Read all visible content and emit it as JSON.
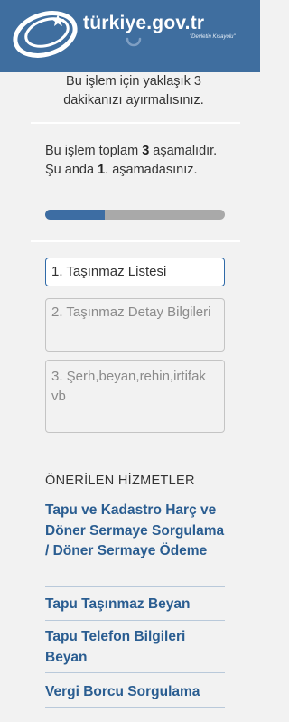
{
  "header": {
    "brand": "türkiye.gov.tr",
    "tagline": "\"Devletin Kısayolu\""
  },
  "info": {
    "time_note": "Bu işlem için yaklaşık 3 dakikanızı ayırmalısınız.",
    "stage_prefix": "Bu işlem toplam ",
    "total_stages": "3",
    "stage_middle": " aşamalıdır. Şu anda ",
    "current_stage": "1",
    "stage_suffix": ". aşamadasınız.",
    "progress_fraction": 0.333
  },
  "steps": [
    {
      "label": "1. Taşınmaz Listesi",
      "active": true
    },
    {
      "label": "2. Taşınmaz Detay Bilgileri",
      "active": false
    },
    {
      "label": "3. Şerh,beyan,rehin,irtifak vb",
      "active": false
    }
  ],
  "recommended": {
    "title": "ÖNERİLEN HİZMETLER",
    "items": [
      "Tapu ve Kadastro Harç ve Döner Sermaye Sorgulama / Döner Sermaye Ödeme",
      "Tapu Taşınmaz Beyan",
      "Tapu Telefon Bilgileri Beyan",
      "Vergi Borcu Sorgulama"
    ]
  },
  "colors": {
    "header": "#3f6e9f",
    "progress_fill": "#3d6da3",
    "progress_track": "#a9a9a9",
    "link": "#2a5d91",
    "active_border": "#2f6aa8"
  }
}
